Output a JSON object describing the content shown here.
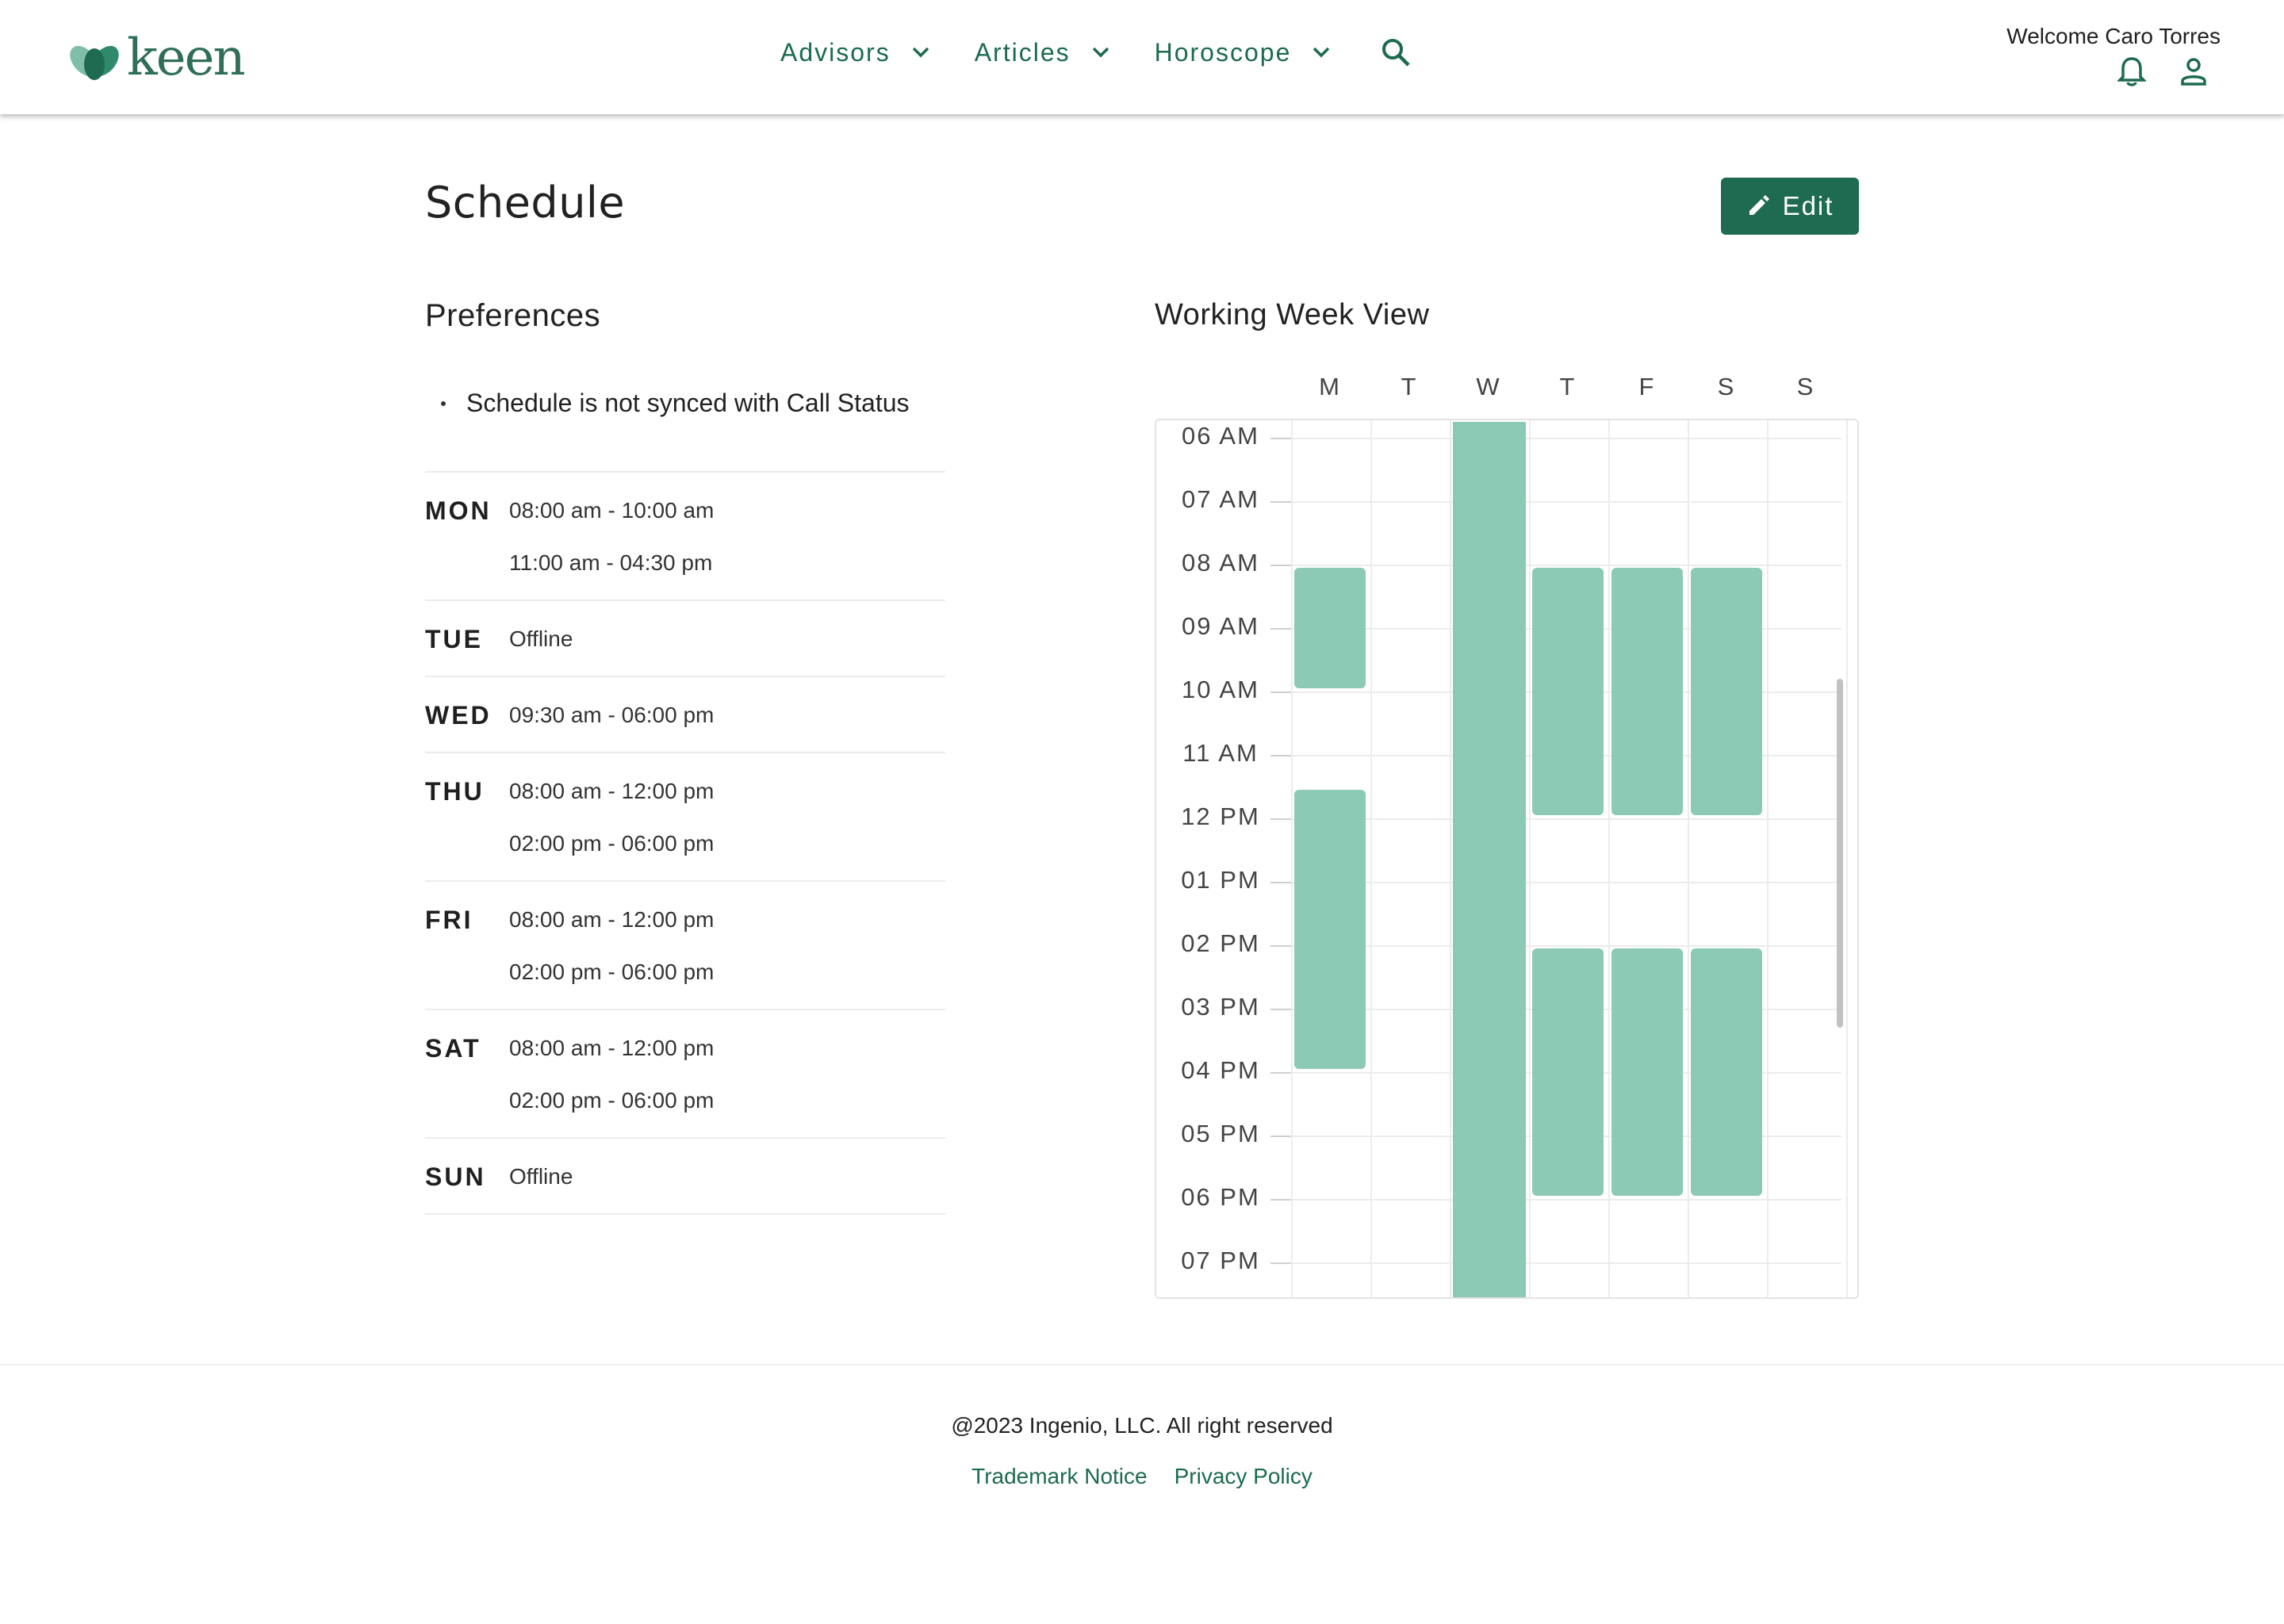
{
  "header": {
    "logo_text": "keen",
    "nav": [
      {
        "label": "Advisors",
        "icon": "chevron-down-icon"
      },
      {
        "label": "Articles",
        "icon": "chevron-down-icon"
      },
      {
        "label": "Horoscope",
        "icon": "chevron-down-icon"
      }
    ],
    "search_icon": "search-icon",
    "welcome": "Welcome Caro Torres",
    "icons": [
      "bell-icon",
      "user-icon"
    ]
  },
  "page": {
    "title": "Schedule",
    "edit_label": "Edit"
  },
  "preferences": {
    "title": "Preferences",
    "note": "Schedule is not synced with Call Status",
    "days": [
      {
        "day": "MON",
        "times": [
          "08:00 am - 10:00 am",
          "11:00 am - 04:30 pm"
        ]
      },
      {
        "day": "TUE",
        "times": [
          "Offline"
        ]
      },
      {
        "day": "WED",
        "times": [
          "09:30 am - 06:00 pm"
        ]
      },
      {
        "day": "THU",
        "times": [
          "08:00 am - 12:00 pm",
          "02:00 pm - 06:00 pm"
        ]
      },
      {
        "day": "FRI",
        "times": [
          "08:00 am - 12:00 pm",
          "02:00 pm - 06:00 pm"
        ]
      },
      {
        "day": "SAT",
        "times": [
          "08:00 am - 12:00 pm",
          "02:00 pm - 06:00 pm"
        ]
      },
      {
        "day": "SUN",
        "times": [
          "Offline"
        ]
      }
    ]
  },
  "week_view": {
    "title": "Working Week View",
    "day_headers": [
      "M",
      "T",
      "W",
      "T",
      "F",
      "S",
      "S"
    ],
    "time_labels": [
      "06 AM",
      "07 AM",
      "08 AM",
      "09 AM",
      "10 AM",
      "11 AM",
      "12 PM",
      "01 PM",
      "02 PM",
      "03 PM",
      "04 PM",
      "05 PM",
      "06 PM",
      "07 PM"
    ],
    "blocks": [
      {
        "day": 0,
        "start": 8.0,
        "end": 10.0
      },
      {
        "day": 0,
        "start": 11.5,
        "end": 16.0
      },
      {
        "day": 2,
        "start": 5.75,
        "end": 20.0
      },
      {
        "day": 3,
        "start": 8.0,
        "end": 12.0
      },
      {
        "day": 3,
        "start": 14.0,
        "end": 18.0
      },
      {
        "day": 4,
        "start": 8.0,
        "end": 12.0
      },
      {
        "day": 4,
        "start": 14.0,
        "end": 18.0
      },
      {
        "day": 5,
        "start": 8.0,
        "end": 12.0
      },
      {
        "day": 5,
        "start": 14.0,
        "end": 18.0
      }
    ],
    "block_color": "#8ccab6"
  },
  "footer": {
    "copyright": "@2023 Ingenio, LLC. All right reserved",
    "links": [
      "Trademark Notice",
      "Privacy Policy"
    ]
  },
  "colors": {
    "brand": "#1e6b52",
    "nav_text": "#1c6b4f",
    "block": "#8ccab6"
  }
}
